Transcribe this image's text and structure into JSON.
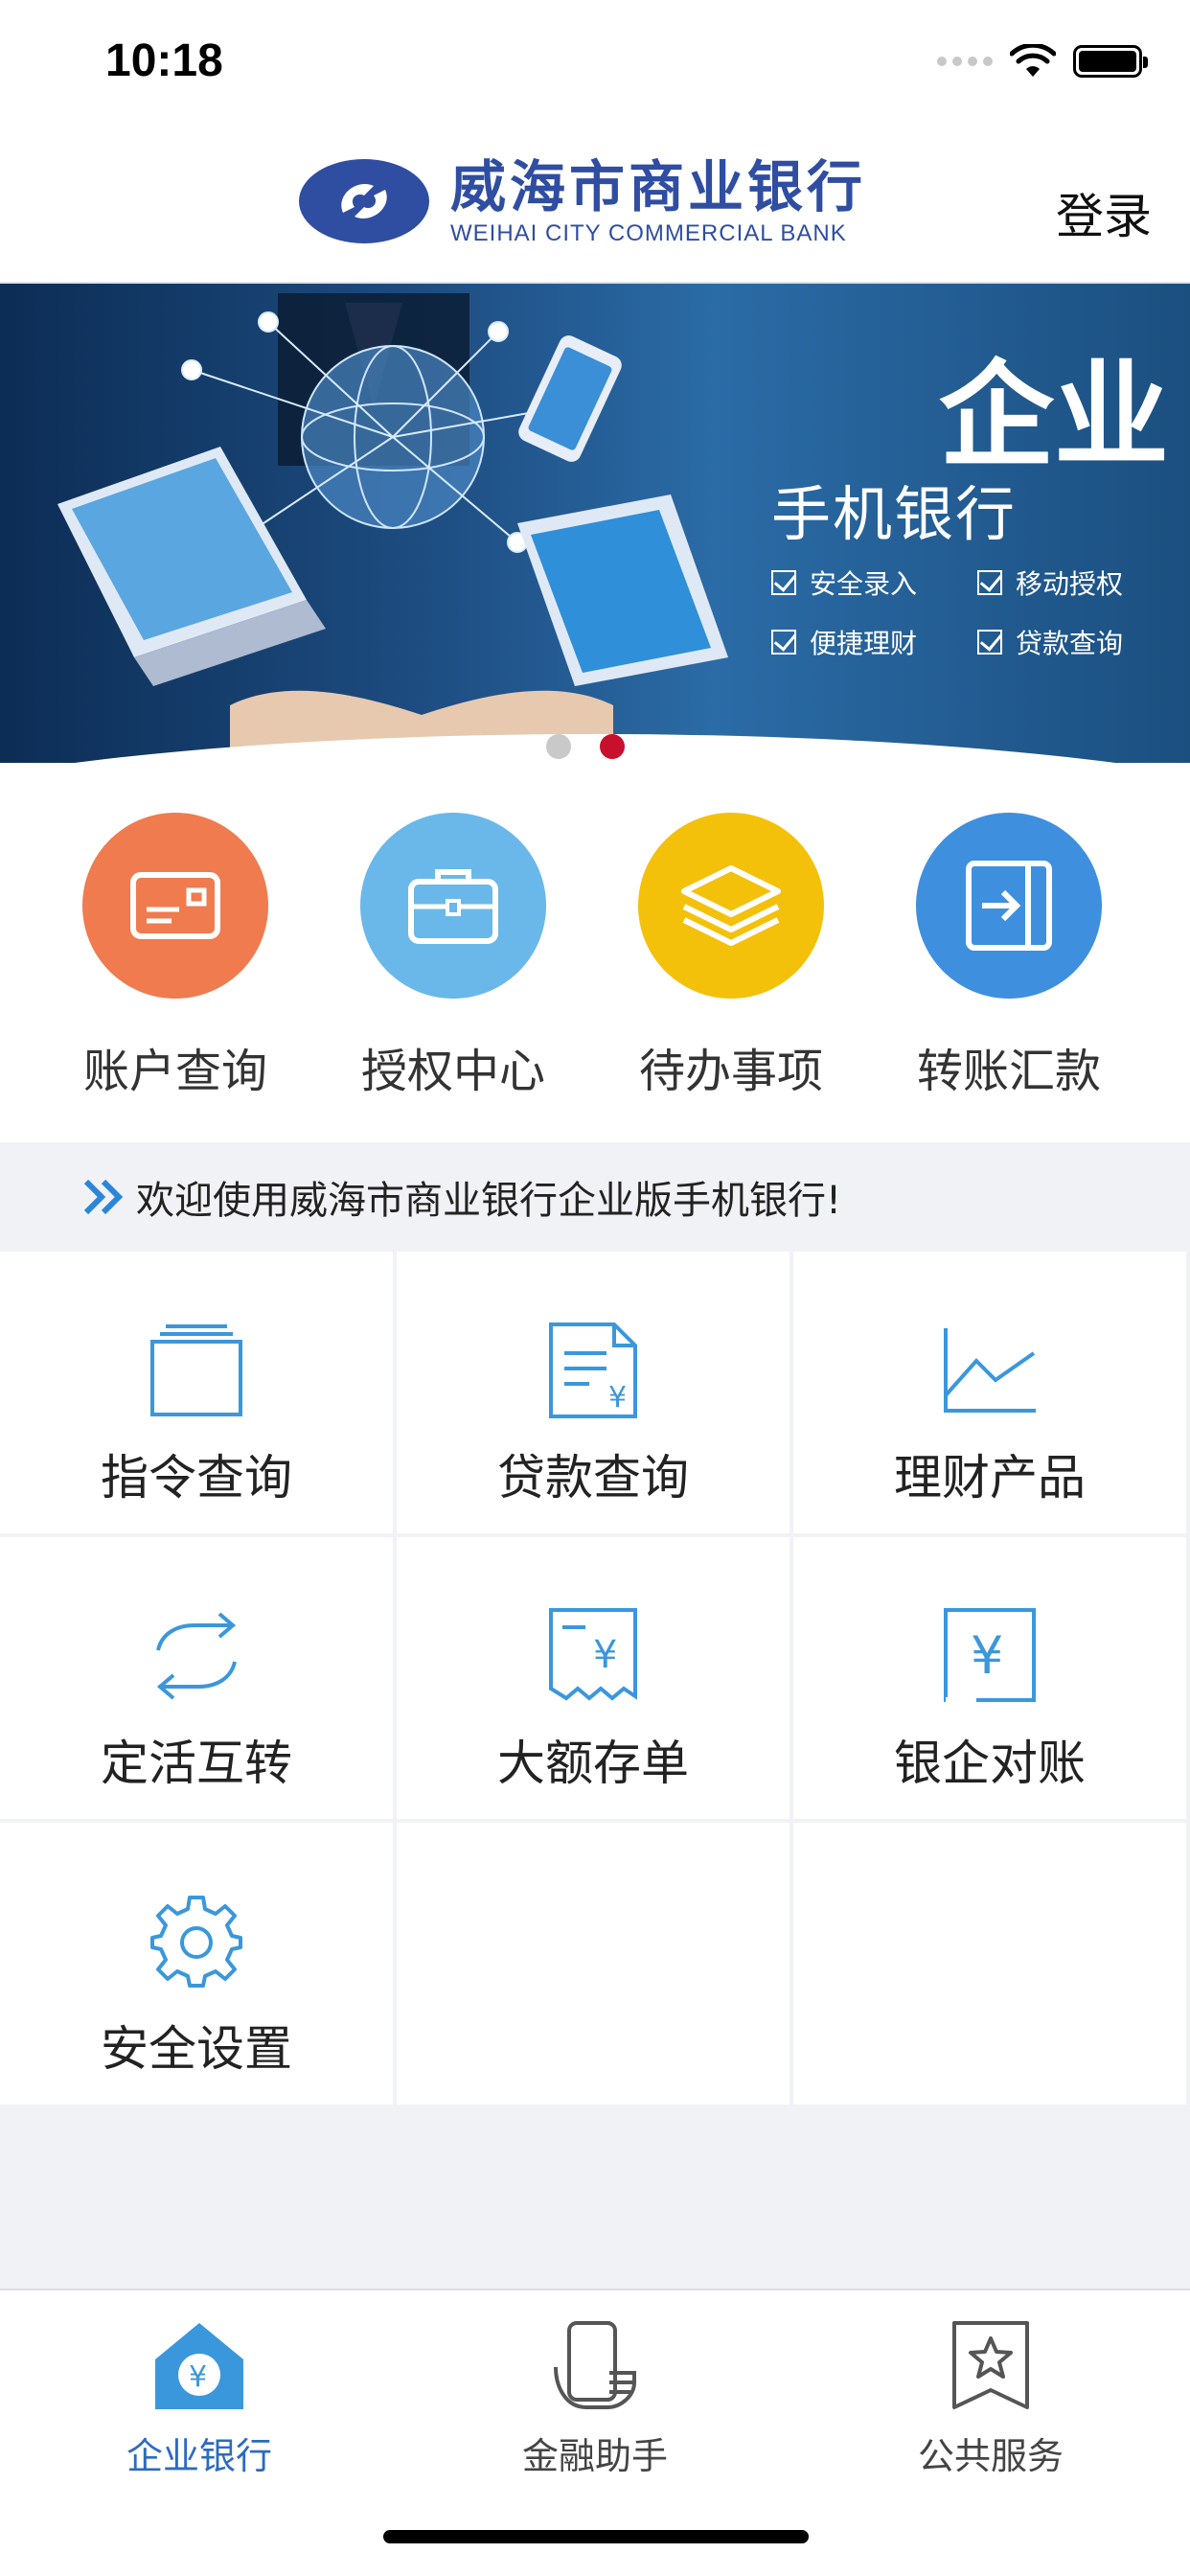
{
  "status": {
    "time": "10:18"
  },
  "header": {
    "logo_cn": "威海市商业银行",
    "logo_en": "WEIHAI CITY COMMERCIAL BANK",
    "login_label": "登录"
  },
  "banner": {
    "big_title": "企业",
    "title": "手机银行",
    "features": [
      "安全录入",
      "移动授权",
      "便捷理财",
      "贷款查询"
    ],
    "active_slide": 2,
    "slide_count": 2
  },
  "quick_actions": [
    {
      "label": "账户查询",
      "icon": "card-icon",
      "color": "#ef7b4f"
    },
    {
      "label": "授权中心",
      "icon": "briefcase-icon",
      "color": "#6ab8ea"
    },
    {
      "label": "待办事项",
      "icon": "layers-icon",
      "color": "#f4c10a"
    },
    {
      "label": "转账汇款",
      "icon": "transfer-icon",
      "color": "#3f8fdf"
    }
  ],
  "notice": {
    "text": "欢迎使用威海市商业银行企业版手机银行!"
  },
  "services": [
    {
      "label": "指令查询",
      "icon": "folder-icon"
    },
    {
      "label": "贷款查询",
      "icon": "document-yuan-icon"
    },
    {
      "label": "理财产品",
      "icon": "line-chart-icon"
    },
    {
      "label": "定活互转",
      "icon": "swap-arrows-icon"
    },
    {
      "label": "大额存单",
      "icon": "receipt-yuan-icon"
    },
    {
      "label": "银企对账",
      "icon": "statement-yuan-icon"
    },
    {
      "label": "安全设置",
      "icon": "gear-icon"
    }
  ],
  "tabs": [
    {
      "label": "企业银行",
      "icon": "home-yuan-icon",
      "active": true
    },
    {
      "label": "金融助手",
      "icon": "phone-hand-icon",
      "active": false
    },
    {
      "label": "公共服务",
      "icon": "star-bookmark-icon",
      "active": false
    }
  ],
  "colors": {
    "accent": "#2c6bc0",
    "icon_line": "#3b97dc",
    "brand": "#2f4ea2",
    "slide_active": "#c8102e"
  }
}
